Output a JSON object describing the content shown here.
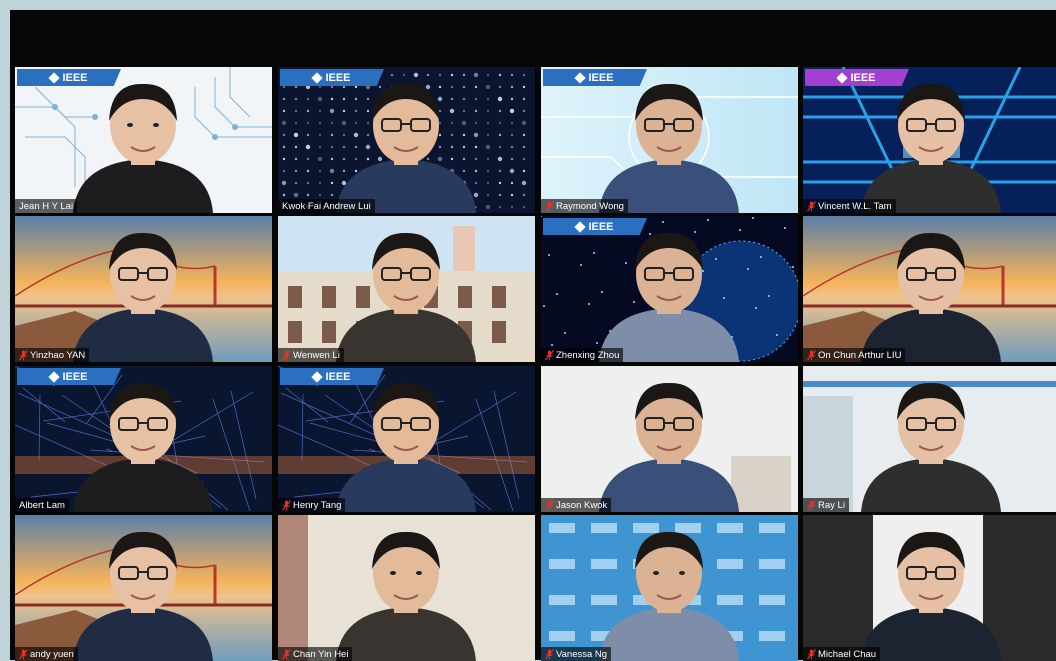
{
  "meeting": {
    "badge_text": "IEEE",
    "participants": [
      {
        "name": "Jean H Y Lai",
        "muted": false,
        "badge": "blue",
        "bg": "circuit-white"
      },
      {
        "name": "Kwok Fai Andrew Lui",
        "muted": false,
        "badge": "blue",
        "bg": "dots-dark"
      },
      {
        "name": "Raymond Wong",
        "muted": true,
        "badge": "blue",
        "bg": "tech-light"
      },
      {
        "name": "Vincent W.L. Tam",
        "muted": true,
        "badge": "purple",
        "bg": "tunnel-blue"
      },
      {
        "name": "Yinzhao YAN",
        "muted": true,
        "badge": "none",
        "bg": "bridge"
      },
      {
        "name": "Wenwen Li",
        "muted": true,
        "badge": "none",
        "bg": "building"
      },
      {
        "name": "Zhenxing Zhou",
        "muted": true,
        "badge": "blue",
        "bg": "globe-dark"
      },
      {
        "name": "On Chun Arthur LIU",
        "muted": true,
        "badge": "none",
        "bg": "bridge"
      },
      {
        "name": "Albert Lam",
        "muted": false,
        "badge": "blue",
        "bg": "network-dark"
      },
      {
        "name": "Henry Tang",
        "muted": true,
        "badge": "blue",
        "bg": "network-dark"
      },
      {
        "name": "Jason Kwok",
        "muted": true,
        "badge": "none",
        "bg": "room-white"
      },
      {
        "name": "Ray Li",
        "muted": true,
        "badge": "none",
        "bg": "room-office"
      },
      {
        "name": "andy yuen",
        "muted": true,
        "badge": "none",
        "bg": "bridge"
      },
      {
        "name": "Chan Yin Hei",
        "muted": true,
        "badge": "none",
        "bg": "room-beige"
      },
      {
        "name": "Vanessa Ng",
        "muted": true,
        "badge": "none",
        "bg": "logo-wall"
      },
      {
        "name": "Michael Chau",
        "muted": true,
        "badge": "none",
        "bg": "room-grey",
        "active": true
      }
    ]
  },
  "colors": {
    "frame": "#060606",
    "badge_blue": "#2a6fc0",
    "badge_purple": "#a13fd0",
    "mute_red": "#e0352b",
    "active_border": "#e8e07a"
  }
}
